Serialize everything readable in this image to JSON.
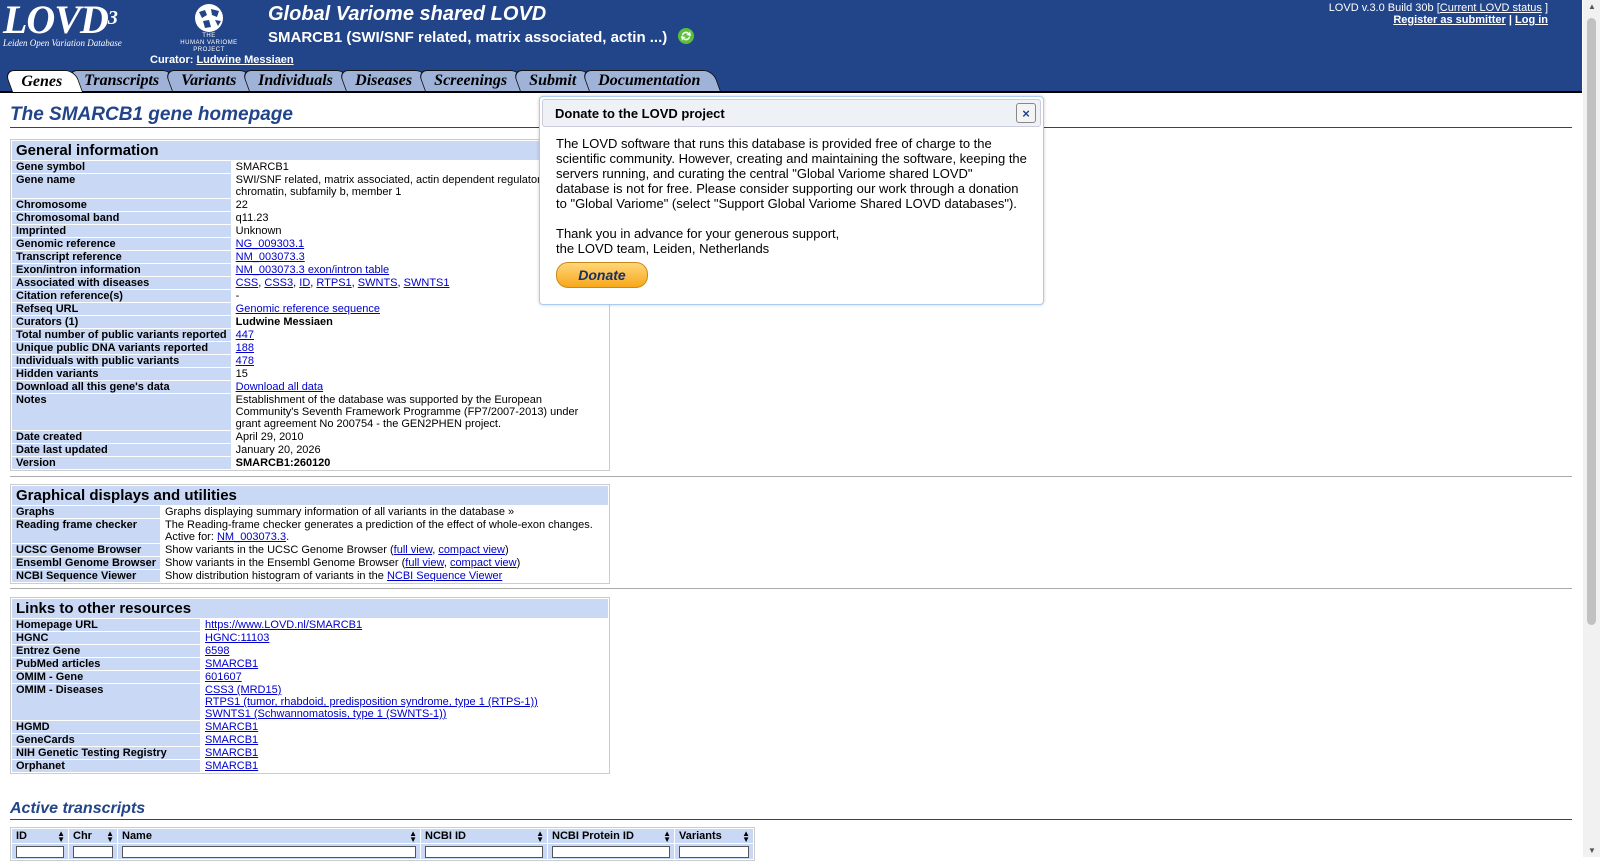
{
  "header": {
    "logo_text": "LOVD",
    "logo_version": "3",
    "logo_sub": "Leiden Open Variation Database",
    "hvp_text": [
      "THE",
      "HUMAN VARIOME",
      "PROJECT"
    ],
    "db_title": "Global Variome shared LOVD",
    "db_subtitle": "SMARCB1 (SWI/SNF related, matrix associated, actin ...)",
    "curator_label": "Curator:",
    "curator_name": "Ludwine Messiaen",
    "version_text": "LOVD v.3.0 Build 30b [",
    "status_link": "Current LOVD status",
    "version_close": "]",
    "register_link": "Register as submitter",
    "sep": "|",
    "login_link": "Log in"
  },
  "tabs": [
    "Genes",
    "Transcripts",
    "Variants",
    "Individuals",
    "Diseases",
    "Screenings",
    "Submit",
    "Documentation"
  ],
  "page_title": "The SMARCB1 gene homepage",
  "general": {
    "caption": "General information",
    "rows": [
      {
        "k": "Gene symbol",
        "v": "SMARCB1"
      },
      {
        "k": "Gene name",
        "v": "SWI/SNF related, matrix associated, actin dependent regulator of chromatin, subfamily b, member 1"
      },
      {
        "k": "Chromosome",
        "v": "22"
      },
      {
        "k": "Chromosomal band",
        "v": "q11.23"
      },
      {
        "k": "Imprinted",
        "v": "Unknown"
      },
      {
        "k": "Genomic reference",
        "link": "NG_009303.1"
      },
      {
        "k": "Transcript reference",
        "link": "NM_003073.3"
      },
      {
        "k": "Exon/intron information",
        "link": "NM_003073.3 exon/intron table"
      },
      {
        "k": "Associated with diseases",
        "links": [
          "CSS",
          "CSS3",
          "ID",
          "RTPS1",
          "SWNTS",
          "SWNTS1"
        ]
      },
      {
        "k": "Citation reference(s)",
        "v": "-"
      },
      {
        "k": "Refseq URL",
        "link": "Genomic reference sequence"
      },
      {
        "k": "Curators (1)",
        "bold": "Ludwine Messiaen"
      },
      {
        "k": "Total number of public variants reported",
        "link": "447"
      },
      {
        "k": "Unique public DNA variants reported",
        "link": "188"
      },
      {
        "k": "Individuals with public variants",
        "link": "478"
      },
      {
        "k": "Hidden variants",
        "v": "15"
      },
      {
        "k": "Download all this gene's data",
        "link": "Download all data"
      },
      {
        "k": "Notes",
        "v": "Establishment of the database was supported by the European Community's Seventh Framework Programme (FP7/2007-2013) under grant agreement No 200754 - the GEN2PHEN project."
      },
      {
        "k": "Date created",
        "v": "April 29, 2010"
      },
      {
        "k": "Date last updated",
        "v": "January 20, 2026"
      },
      {
        "k": "Version",
        "bold": "SMARCB1:260120"
      }
    ]
  },
  "graphical": {
    "caption": "Graphical displays and utilities",
    "graphs_k": "Graphs",
    "graphs_v": "Graphs displaying summary information of all variants in the database »",
    "rf_k": "Reading frame checker",
    "rf_v1": "The Reading-frame checker generates a prediction of the effect of whole-exon changes.",
    "rf_v2": "Active for:",
    "rf_link": "NM_003073.3",
    "rf_end": ".",
    "ucsc_k": "UCSC Genome Browser",
    "ucsc_v": "Show variants in the UCSC Genome Browser (",
    "ucsc_full": "full view",
    "comma": ",",
    "ucsc_compact": "compact view",
    "close_paren": ")",
    "ens_k": "Ensembl Genome Browser",
    "ens_v": "Show variants in the Ensembl Genome Browser (",
    "ens_full": "full view",
    "ens_compact": "compact view",
    "ncbi_k": "NCBI Sequence Viewer",
    "ncbi_v": "Show distribution histogram of variants in the",
    "ncbi_link": "NCBI Sequence Viewer"
  },
  "links": {
    "caption": "Links to other resources",
    "homepage_k": "Homepage URL",
    "homepage_v": "https://www.LOVD.nl/SMARCB1",
    "hgnc_k": "HGNC",
    "hgnc_v": "HGNC:11103",
    "entrez_k": "Entrez Gene",
    "entrez_v": "6598",
    "pubmed_k": "PubMed articles",
    "pubmed_v": "SMARCB1",
    "omimg_k": "OMIM - Gene",
    "omimg_v": "601607",
    "omimd_k": "OMIM - Diseases",
    "omimd_v": [
      "CSS3 (MRD15)",
      "RTPS1 (tumor, rhabdoid, predisposition syndrome, type 1 (RTPS-1))",
      "SWNTS1 (Schwannomatosis, type 1 (SWNTS-1))"
    ],
    "hgmd_k": "HGMD",
    "hgmd_v": "SMARCB1",
    "genecards_k": "GeneCards",
    "genecards_v": "SMARCB1",
    "nih_k": "NIH Genetic Testing Registry",
    "nih_v": "SMARCB1",
    "orphanet_k": "Orphanet",
    "orphanet_v": "SMARCB1"
  },
  "active_transcripts": {
    "title": "Active transcripts",
    "columns": [
      "ID",
      "Chr",
      "Name",
      "NCBI ID",
      "NCBI Protein ID",
      "Variants"
    ]
  },
  "donate": {
    "title": "Donate to the LOVD project",
    "close": "×",
    "p1": "The LOVD software that runs this database is provided free of charge to the scientific community. However, creating and maintaining the software, keeping the servers running, and curating the central \"Global Variome shared LOVD\" database is not for free. Please consider supporting our work through a donation to \"Global Variome\" (select \"Support Global Variome Shared LOVD databases\").",
    "p2a": "Thank you in advance for your generous support,",
    "p2b": "the LOVD team, Leiden, Netherlands",
    "button": "Donate"
  },
  "colors": {
    "header_bg": "#224488",
    "table_key_bg": "#c9d8f5",
    "tab_bg": "#9fb3d9",
    "link": "#0000cc"
  }
}
